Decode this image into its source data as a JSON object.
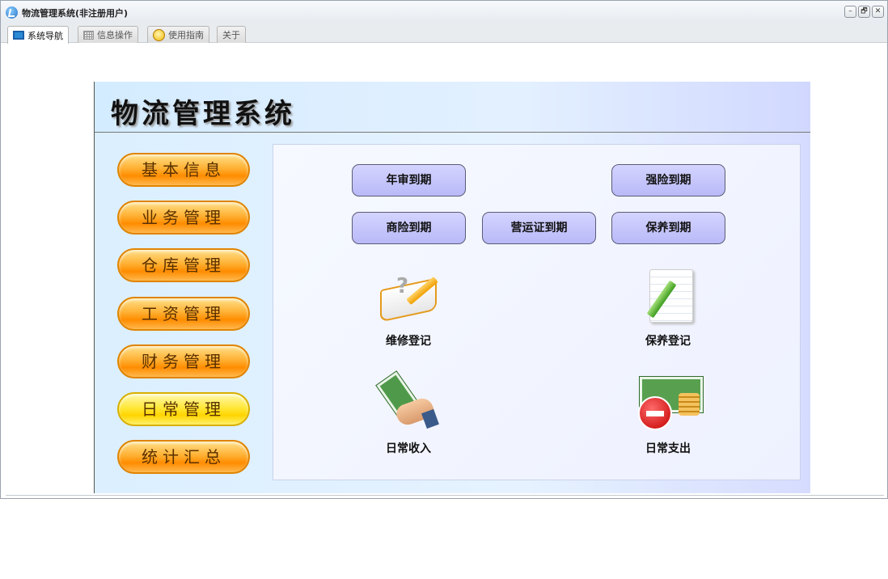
{
  "window": {
    "title": "物流管理系统(非注册用户)",
    "controls": [
      "–",
      "🗗",
      "✕"
    ]
  },
  "tabs": [
    {
      "label": "系统导航",
      "icon": "monitor-icon",
      "active": true
    },
    {
      "label": "信息操作",
      "icon": "grid-icon",
      "active": false
    },
    {
      "label": "使用指南",
      "icon": "help-icon",
      "active": false
    },
    {
      "label": "关于",
      "icon": "",
      "active": false
    }
  ],
  "header": {
    "title": "物流管理系统"
  },
  "menu": [
    {
      "label": "基本信息"
    },
    {
      "label": "业务管理"
    },
    {
      "label": "仓库管理"
    },
    {
      "label": "工资管理"
    },
    {
      "label": "财务管理"
    },
    {
      "label": "日常管理",
      "selected": true
    },
    {
      "label": "统计汇总"
    }
  ],
  "due_buttons": {
    "annual": "年审到期",
    "compulsory": "强险到期",
    "commercial": "商险到期",
    "operation": "营运证到期",
    "maintenance": "保养到期"
  },
  "functions": {
    "repair": {
      "label": "维修登记",
      "icon": "repair-book-icon"
    },
    "maintain": {
      "label": "保养登记",
      "icon": "record-pencil-icon"
    },
    "income": {
      "label": "日常收入",
      "icon": "money-hand-icon"
    },
    "expense": {
      "label": "日常支出",
      "icon": "money-stop-icon"
    }
  },
  "colors": {
    "menu_orange": "#ff8c00",
    "menu_yellow": "#ffd500",
    "due_button": "#c4c4fc",
    "panel_bg": "#dbefff"
  }
}
